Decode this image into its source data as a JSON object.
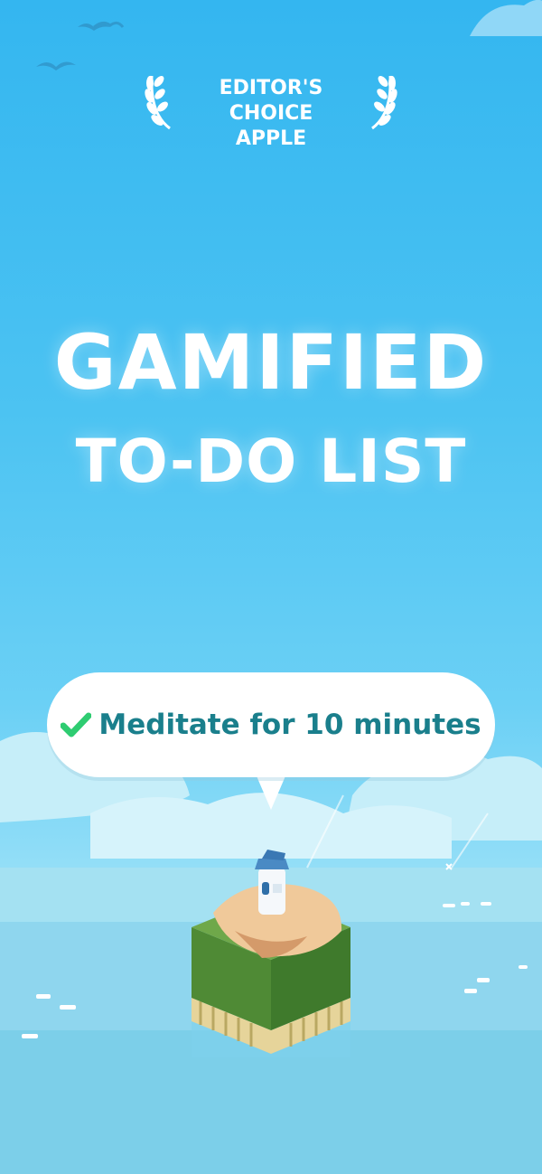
{
  "badge": {
    "line1": "EDITOR'S CHOICE",
    "line2": "APPLE",
    "left_icon": "laurel-icon",
    "right_icon": "laurel-icon"
  },
  "headline": {
    "line1": "GAMIFIED",
    "line2": "TO-DO LIST"
  },
  "task": {
    "text": "Meditate for 10 minutes",
    "icon": "checkmark-icon",
    "check_color": "#2ecc71",
    "text_color": "#1a7f8c"
  },
  "colors": {
    "sky_top": "#34b6f0",
    "sky_bottom": "#a9e6f8",
    "sea": "#8fd6ee",
    "text": "#ffffff"
  }
}
